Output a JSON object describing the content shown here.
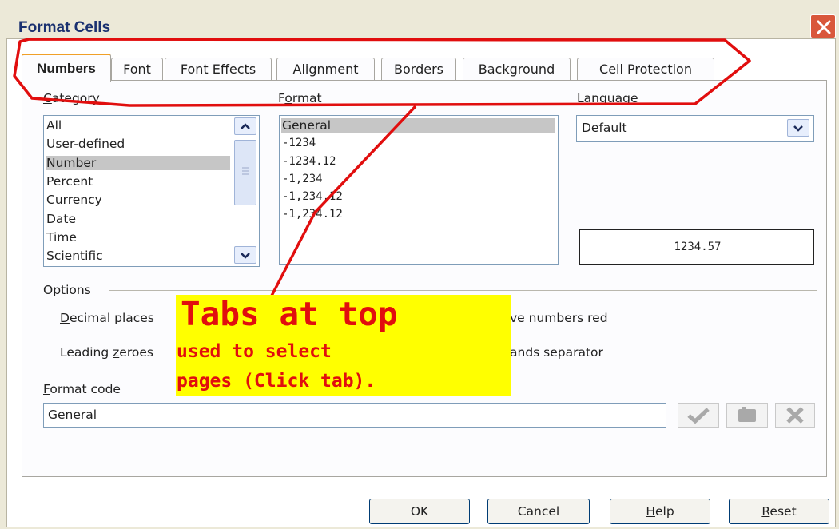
{
  "dialog": {
    "title": "Format Cells",
    "close_icon": "close-icon"
  },
  "tabs": [
    {
      "label": "Numbers",
      "active": true
    },
    {
      "label": "Font",
      "active": false
    },
    {
      "label": "Font Effects",
      "active": false
    },
    {
      "label": "Alignment",
      "active": false
    },
    {
      "label": "Borders",
      "active": false
    },
    {
      "label": "Background",
      "active": false
    },
    {
      "label": "Cell Protection",
      "active": false
    }
  ],
  "category": {
    "label": "Category",
    "items": [
      "All",
      "User-defined",
      "Number",
      "Percent",
      "Currency",
      "Date",
      "Time",
      "Scientific"
    ],
    "selected": "Number"
  },
  "format": {
    "label": "Format",
    "items": [
      "General",
      "-1234",
      "-1234.12",
      "-1,234",
      "-1,234.12",
      "-1,234.12"
    ],
    "selected": "General"
  },
  "language": {
    "label": "Language",
    "value": "Default"
  },
  "preview": {
    "value": "1234.57"
  },
  "options": {
    "label": "Options",
    "decimal_places_label": "Decimal places",
    "negative_red_label_visible": "ve numbers red",
    "leading_zeroes_label": "Leading zeroes",
    "thousands_label_visible": "ands separator"
  },
  "format_code": {
    "label": "Format code",
    "value": "General"
  },
  "buttons": {
    "ok": "OK",
    "cancel": "Cancel",
    "help": "Help",
    "reset": "Reset"
  },
  "annotation": {
    "headline": "Tabs at top",
    "line1": "used to select",
    "line2": "pages (Click tab).",
    "color": "#e10e0e",
    "highlight": "#ffff00"
  }
}
